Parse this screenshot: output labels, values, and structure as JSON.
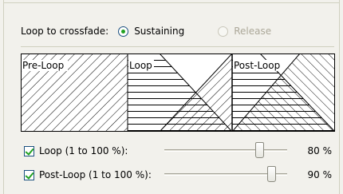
{
  "mode": {
    "label": "Loop to crossfade:",
    "options": [
      {
        "label": "Sustaining",
        "selected": true,
        "enabled": true
      },
      {
        "label": "Release",
        "selected": false,
        "enabled": false
      }
    ]
  },
  "diagram": {
    "labels": {
      "pre_loop": "Pre-Loop",
      "loop": "Loop",
      "post_loop": "Post-Loop"
    }
  },
  "settings": {
    "loop": {
      "label": "Loop (1 to 100 %):",
      "checked": true,
      "value": 80,
      "value_text": "80 %"
    },
    "post_loop": {
      "label": "Post-Loop (1 to 100 %):",
      "checked": true,
      "value": 90,
      "value_text": "90 %"
    }
  },
  "colors": {
    "check_green": "#21a121",
    "control_border": "#1c5180",
    "disabled_text": "#aca899"
  }
}
